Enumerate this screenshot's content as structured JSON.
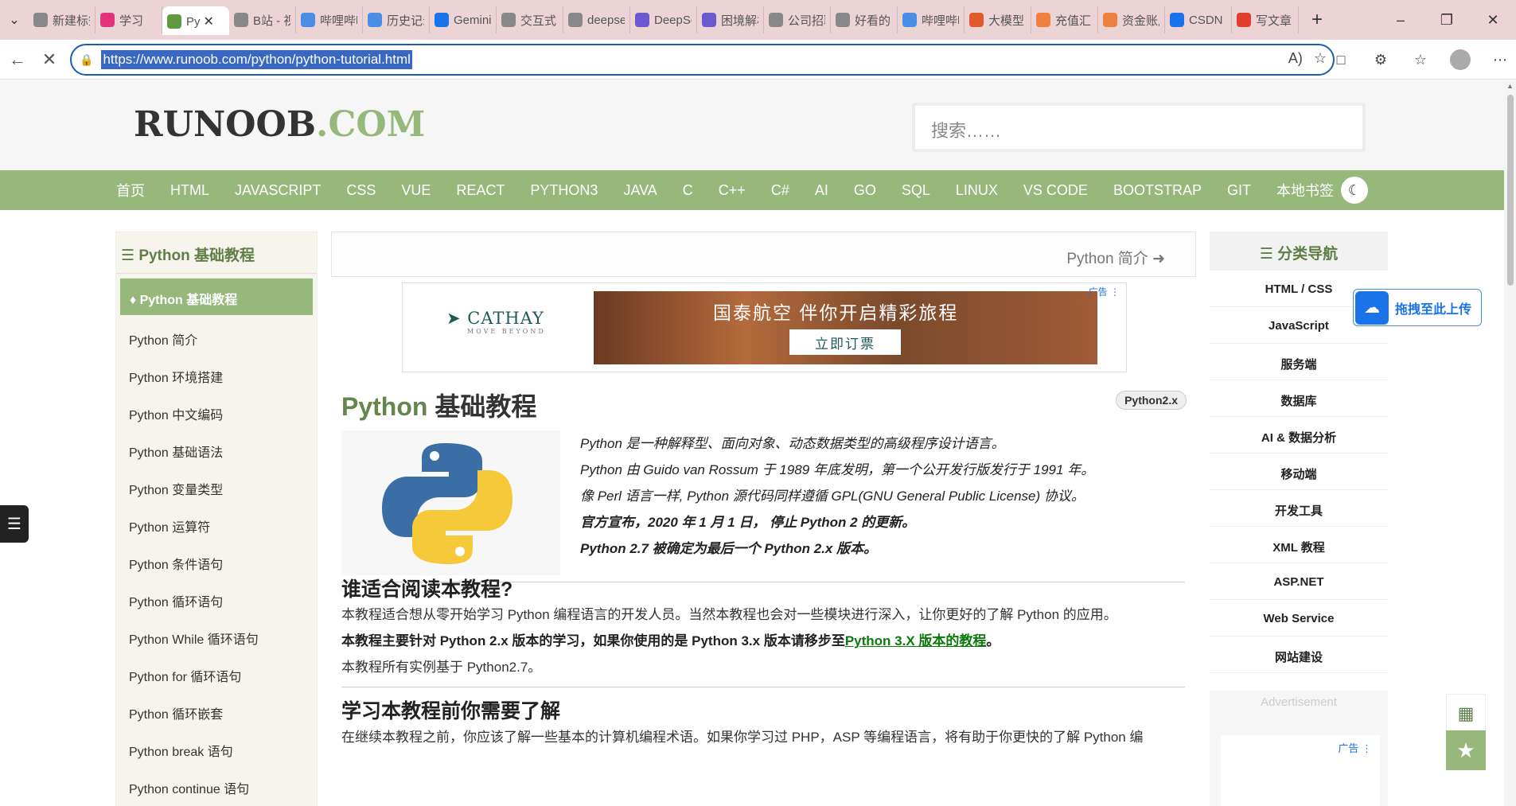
{
  "browser": {
    "tabs": [
      {
        "label": "新建标签页",
        "color": "#888888"
      },
      {
        "label": "学习",
        "color": "#e0337a"
      },
      {
        "label": "Py",
        "color": "#5f9b3e",
        "active": true
      },
      {
        "label": "B站 - 视频",
        "color": "#888888"
      },
      {
        "label": "哔哩哔哩",
        "color": "#4a8de5"
      },
      {
        "label": "历史记录",
        "color": "#4a8de5"
      },
      {
        "label": "Gemini",
        "color": "#1a73e8"
      },
      {
        "label": "交互式",
        "color": "#888888"
      },
      {
        "label": "deepseek",
        "color": "#888888"
      },
      {
        "label": "DeepSeek",
        "color": "#6a5acd"
      },
      {
        "label": "困境解析",
        "color": "#6a5acd"
      },
      {
        "label": "公司招聘",
        "color": "#888888"
      },
      {
        "label": "好看的",
        "color": "#888888"
      },
      {
        "label": "哔哩哔哩",
        "color": "#4a8de5"
      },
      {
        "label": "大模型",
        "color": "#e05a2b"
      },
      {
        "label": "充值汇",
        "color": "#f08040"
      },
      {
        "label": "资金账户",
        "color": "#f08040"
      },
      {
        "label": "CSDN",
        "color": "#1a73e8"
      },
      {
        "label": "写文章",
        "color": "#e0402b"
      }
    ],
    "url": "https://www.runoob.com/python/python-tutorial.html"
  },
  "site": {
    "logo_main": "RUNOOB",
    "logo_suffix": ".COM",
    "search_placeholder": "搜索……",
    "nav": [
      "首页",
      "HTML",
      "JAVASCRIPT",
      "CSS",
      "VUE",
      "REACT",
      "PYTHON3",
      "JAVA",
      "C",
      "C++",
      "C#",
      "AI",
      "GO",
      "SQL",
      "LINUX",
      "VS CODE",
      "BOOTSTRAP",
      "GIT",
      "本地书签"
    ]
  },
  "left_sidebar": {
    "heading": "Python 基础教程",
    "active_item": "Python 基础教程",
    "items": [
      "Python 简介",
      "Python 环境搭建",
      "Python 中文编码",
      "Python 基础语法",
      "Python 变量类型",
      "Python 运算符",
      "Python 条件语句",
      "Python 循环语句",
      "Python While 循环语句",
      "Python for 循环语句",
      "Python 循环嵌套",
      "Python break 语句",
      "Python continue 语句"
    ]
  },
  "content": {
    "next_link": "Python 简介",
    "ad": {
      "brand": "CATHAY",
      "brand_tag": "MOVE BEYOND",
      "headline": "国泰航空 伴你开启精彩旅程",
      "cta": "立即订票",
      "tag": "广告"
    },
    "title_green": "Python",
    "title_rest": " 基础教程",
    "version_badge": "Python2.x",
    "intro": [
      "Python 是一种解释型、面向对象、动态数据类型的高级程序设计语言。",
      "Python 由 Guido van Rossum 于 1989 年底发明，第一个公开发行版发行于 1991 年。",
      "像 Perl 语言一样, Python 源代码同样遵循 GPL(GNU General Public License) 协议。",
      "官方宣布，2020 年 1 月 1 日， 停止 Python 2 的更新。",
      "Python 2.7 被确定为最后一个 Python 2.x 版本。"
    ],
    "section1_title": "谁适合阅读本教程?",
    "section1_p1": "本教程适合想从零开始学习 Python 编程语言的开发人员。当然本教程也会对一些模块进行深入，让你更好的了解 Python 的应用。",
    "section1_p2": "本教程主要针对 Python 2.x 版本的学习，如果你使用的是 Python 3.x 版本请移步至",
    "section1_link": "Python 3.X 版本的教程",
    "section1_p2_end": "。",
    "section1_p3": "本教程所有实例基于 Python2.7。",
    "section2_title": "学习本教程前你需要了解",
    "section2_p1": "在继续本教程之前，你应该了解一些基本的计算机编程术语。如果你学习过 PHP，ASP 等编程语言，将有助于你更快的了解 Python 编"
  },
  "right_sidebar": {
    "heading": "分类导航",
    "items": [
      "HTML / CSS",
      "JavaScript",
      "服务端",
      "数据库",
      "AI & 数据分析",
      "移动端",
      "开发工具",
      "XML 教程",
      "ASP.NET",
      "Web Service",
      "网站建设"
    ],
    "ad_label": "Advertisement",
    "ad_tag": "广告"
  },
  "floating": {
    "upload_label": "拖拽至此上传"
  }
}
